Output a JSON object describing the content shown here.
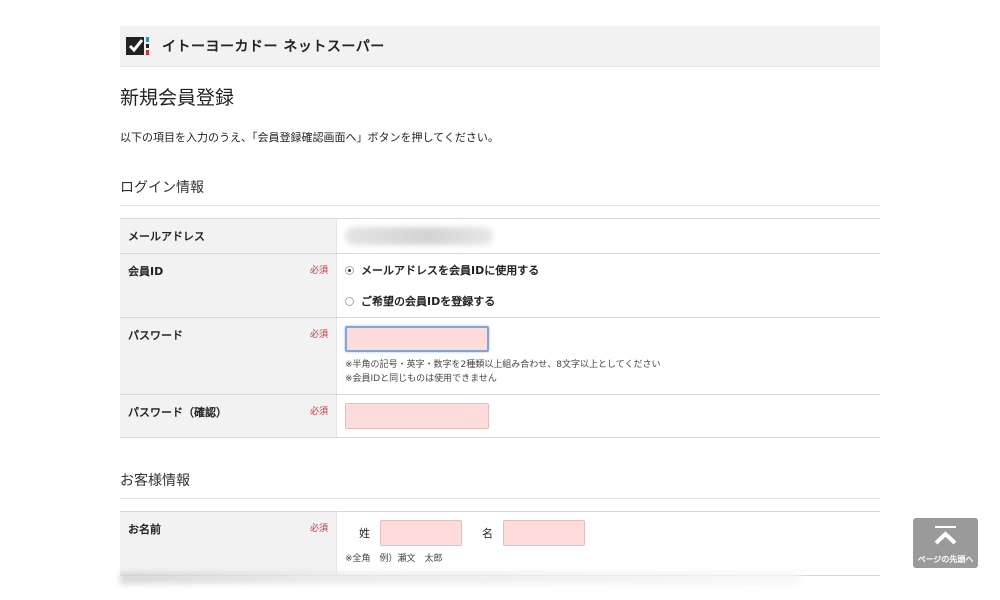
{
  "header": {
    "store_name": "イトーヨーカドー ネットスーパー",
    "logo_icon": "ito-yokado-logo-icon"
  },
  "page": {
    "title": "新規会員登録",
    "intro": "以下の項目を入力のうえ、「会員登録確認画面へ」ボタンを押してください。"
  },
  "login_section": {
    "title": "ログイン情報",
    "rows": {
      "email": {
        "label": "メールアドレス"
      },
      "member_id": {
        "label": "会員ID",
        "required": "必須",
        "option_use_email": "メールアドレスを会員IDに使用する",
        "option_custom": "ご希望の会員IDを登録する",
        "selected": "option_use_email"
      },
      "password": {
        "label": "パスワード",
        "required": "必須",
        "value": "",
        "note1": "※半角の記号・英字・数字を2種類以上組み合わせ、8文字以上としてください",
        "note2": "※会員IDと同じものは使用できません"
      },
      "password_confirm": {
        "label": "パスワード（確認）",
        "required": "必須",
        "value": ""
      }
    }
  },
  "customer_section": {
    "title": "お客様情報",
    "rows": {
      "name": {
        "label": "お名前",
        "required": "必須",
        "last_name_label": "姓",
        "first_name_label": "名",
        "note": "※全角　例）瀬文　太郎"
      }
    }
  },
  "back_to_top": {
    "label": "ページの先頭へ",
    "icon": "chevron-up-icon"
  },
  "colors": {
    "required": "#d0313a",
    "input_pink": "#ffdcdc",
    "header_bg": "#f2f2f2",
    "focus_border": "#7fa6d6",
    "back_top_bg": "#9a9a9a"
  }
}
